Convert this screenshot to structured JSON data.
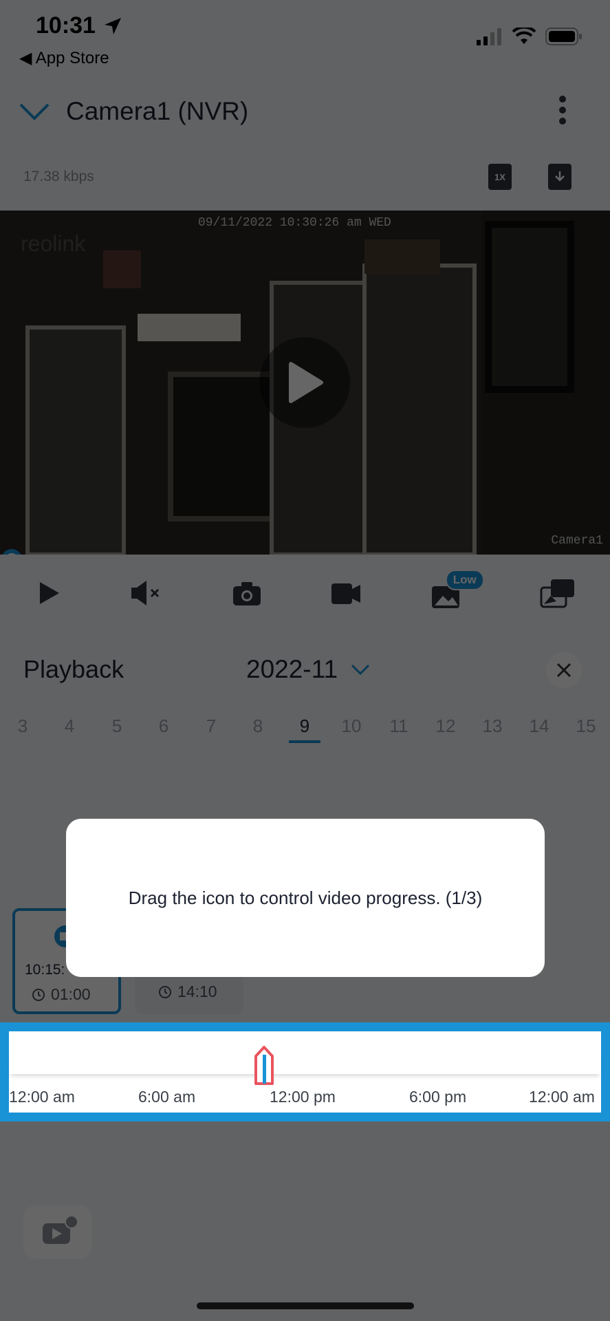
{
  "status_bar": {
    "time": "10:31",
    "back_app": "◀ App Store"
  },
  "header": {
    "title": "Camera1 (NVR)",
    "bitrate": "17.38 kbps",
    "speed_label": "1X"
  },
  "video": {
    "timestamp": "09/11/2022 10:30:26 am WED",
    "watermark": "reolink",
    "camera_label": "Camera1"
  },
  "controls": {
    "quality_badge": "Low"
  },
  "playback": {
    "label": "Playback",
    "month": "2022-11",
    "days": [
      "3",
      "4",
      "5",
      "6",
      "7",
      "8",
      "9",
      "10",
      "11",
      "12",
      "13",
      "14",
      "15"
    ],
    "selected_day": "9"
  },
  "clips": [
    {
      "time": "10:15:",
      "duration": "01:00"
    },
    {
      "time": "",
      "duration": "14:10"
    }
  ],
  "timeline": {
    "labels": [
      "12:00 am",
      "6:00 am",
      "12:00 pm",
      "6:00 pm",
      "12:00 am"
    ]
  },
  "tooltip": {
    "text": "Drag the icon to control video progress. (1/3)"
  },
  "colors": {
    "accent": "#1a92d6",
    "handle": "#e8555f"
  }
}
